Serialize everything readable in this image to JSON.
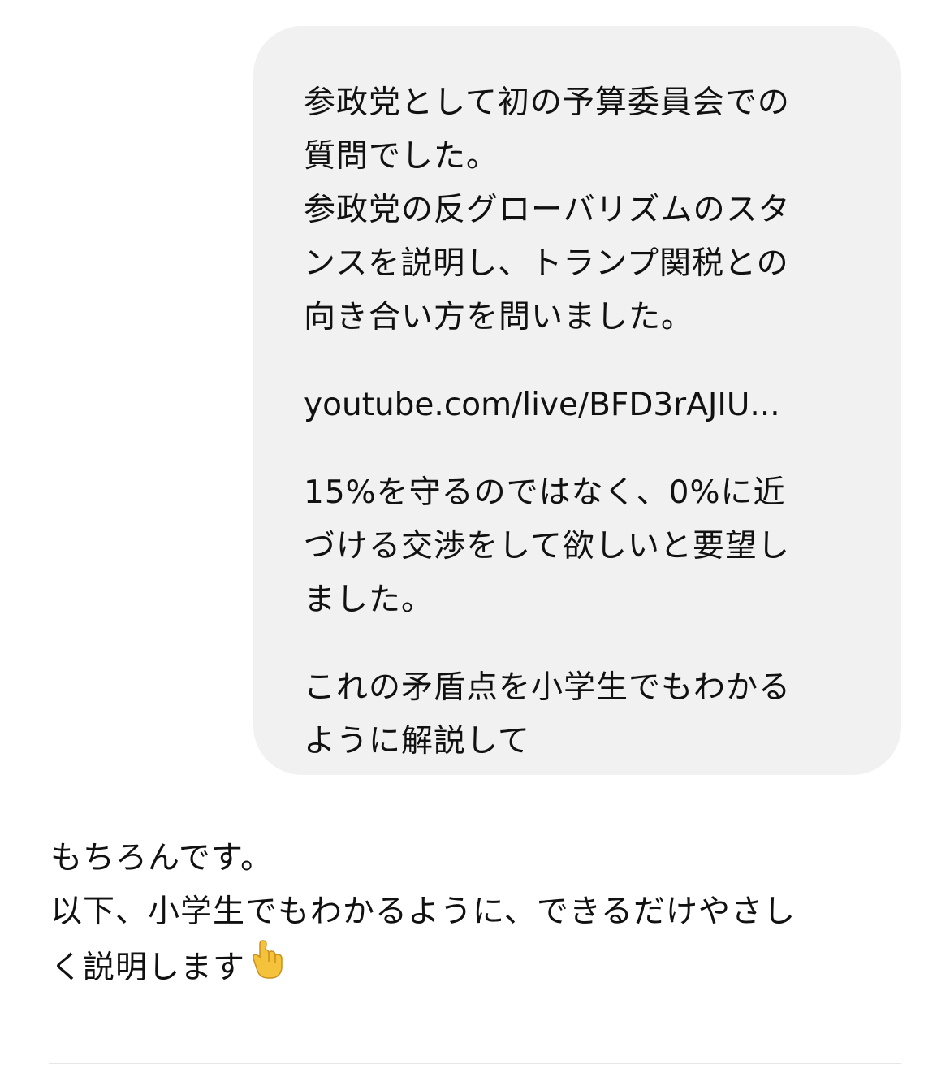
{
  "user_message": {
    "para1": [
      "参政党として初の予算委員会での",
      "質問でした。",
      "参政党の反グローバリズムのスタ",
      "ンスを説明し、トランプ関税との",
      "向き合い方を問いました。"
    ],
    "link": "youtube.com/live/BFD3rAJIU...",
    "para2": [
      "15%を守るのではなく、0%に近",
      "づける交渉をして欲しいと要望し",
      "ました。"
    ],
    "para3": [
      "これの矛盾点を小学生でもわかる",
      "ように解説して"
    ]
  },
  "assistant_message": {
    "lines": [
      "もちろんです。",
      "以下、小学生でもわかるように、できるだけやさし",
      "く説明します"
    ],
    "emoji_icon": "pointing-down-hand-icon",
    "emoji_color": "#F5C33B"
  }
}
